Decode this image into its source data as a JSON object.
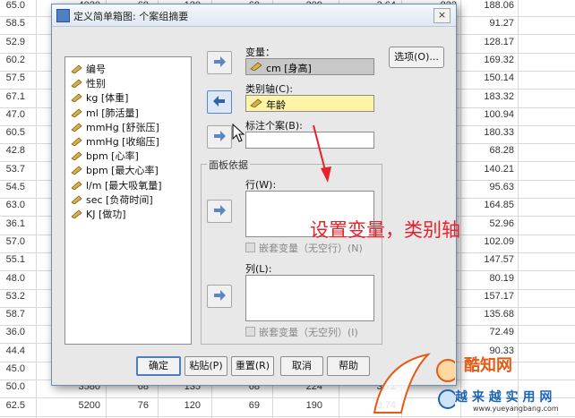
{
  "dialog": {
    "title": "定义简单箱图: 个案组摘要",
    "close_label": "×",
    "variables": [
      "编号",
      "性别",
      "kg [体重]",
      "ml [肺活量]",
      "mmHg [舒张压]",
      "mmHg [收缩压]",
      "bpm [心率]",
      "bpm [最大心率]",
      "l/m [最大吸氧量]",
      "sec [负荷时间]",
      "KJ [做功]"
    ],
    "variable_label": "变量：",
    "variable_value": "cm [身高]",
    "category_label": "类别轴(C):",
    "category_value": "年龄",
    "label_cases_label": "标注个案(B):",
    "label_cases_value": "",
    "options_label": "选项(O)...",
    "panel_label": "面板依据",
    "rows_label": "行(W):",
    "rows_nest": "嵌套变量（无空行）(N)",
    "cols_label": "列(L):",
    "cols_nest": "嵌套变量（无空列）(I)",
    "buttons": {
      "ok": "确定",
      "paste": "粘贴(P)",
      "reset": "重置(R)",
      "cancel": "取消",
      "help": "帮助"
    }
  },
  "annotation": "设置变量，类别轴",
  "watermark": {
    "logo_text": "酷知网",
    "sub_text": "越 来 越 实 用 网",
    "url": "www.yueyangbang.com"
  },
  "spreadsheet": {
    "rows": [
      [
        "65.0",
        "4020",
        "69",
        "120",
        "69",
        "209",
        "3.64",
        "823",
        "188.06"
      ],
      [
        "58.5",
        "",
        "",
        "",
        "",
        "",
        "",
        "",
        "91.27"
      ],
      [
        "52.9",
        "",
        "",
        "",
        "",
        "",
        "",
        "",
        "128.17"
      ],
      [
        "60.2",
        "",
        "",
        "",
        "",
        "",
        "",
        "",
        "169.32"
      ],
      [
        "57.5",
        "",
        "",
        "",
        "",
        "",
        "",
        "",
        "150.14"
      ],
      [
        "67.1",
        "",
        "",
        "",
        "",
        "",
        "",
        "",
        "183.32"
      ],
      [
        "47.0",
        "",
        "",
        "",
        "",
        "",
        "",
        "",
        "100.94"
      ],
      [
        "60.5",
        "",
        "",
        "",
        "",
        "",
        "",
        "",
        "180.33"
      ],
      [
        "42.8",
        "",
        "",
        "",
        "",
        "",
        "",
        "",
        "68.28"
      ],
      [
        "53.7",
        "",
        "",
        "",
        "",
        "",
        "",
        "",
        "140.21"
      ],
      [
        "54.5",
        "",
        "",
        "",
        "",
        "",
        "",
        "",
        "95.63"
      ],
      [
        "63.0",
        "",
        "",
        "",
        "",
        "",
        "",
        "",
        "164.85"
      ],
      [
        "36.1",
        "",
        "",
        "",
        "",
        "",
        "",
        "",
        "52.96"
      ],
      [
        "57.0",
        "",
        "",
        "",
        "",
        "",
        "",
        "",
        "102.09"
      ],
      [
        "55.1",
        "",
        "",
        "",
        "",
        "",
        "",
        "",
        "147.57"
      ],
      [
        "48.0",
        "",
        "",
        "",
        "",
        "",
        "",
        "",
        "80.19"
      ],
      [
        "53.2",
        "",
        "",
        "",
        "",
        "",
        "",
        "",
        "157.17"
      ],
      [
        "58.7",
        "",
        "",
        "",
        "",
        "",
        "",
        "",
        "135.68"
      ],
      [
        "36.0",
        "",
        "",
        "",
        "",
        "",
        "",
        "",
        "72.49"
      ],
      [
        "44.4",
        "",
        "",
        "",
        "",
        "",
        "",
        "",
        "90.33"
      ],
      [
        "45.0",
        "",
        "",
        "",
        "",
        "",
        "",
        "",
        ""
      ],
      [
        "50.0",
        "3580",
        "68",
        "135",
        "68",
        "224",
        "3.72",
        "",
        ""
      ],
      [
        "62.5",
        "5200",
        "76",
        "120",
        "69",
        "190",
        "3.74",
        "",
        ""
      ]
    ]
  }
}
